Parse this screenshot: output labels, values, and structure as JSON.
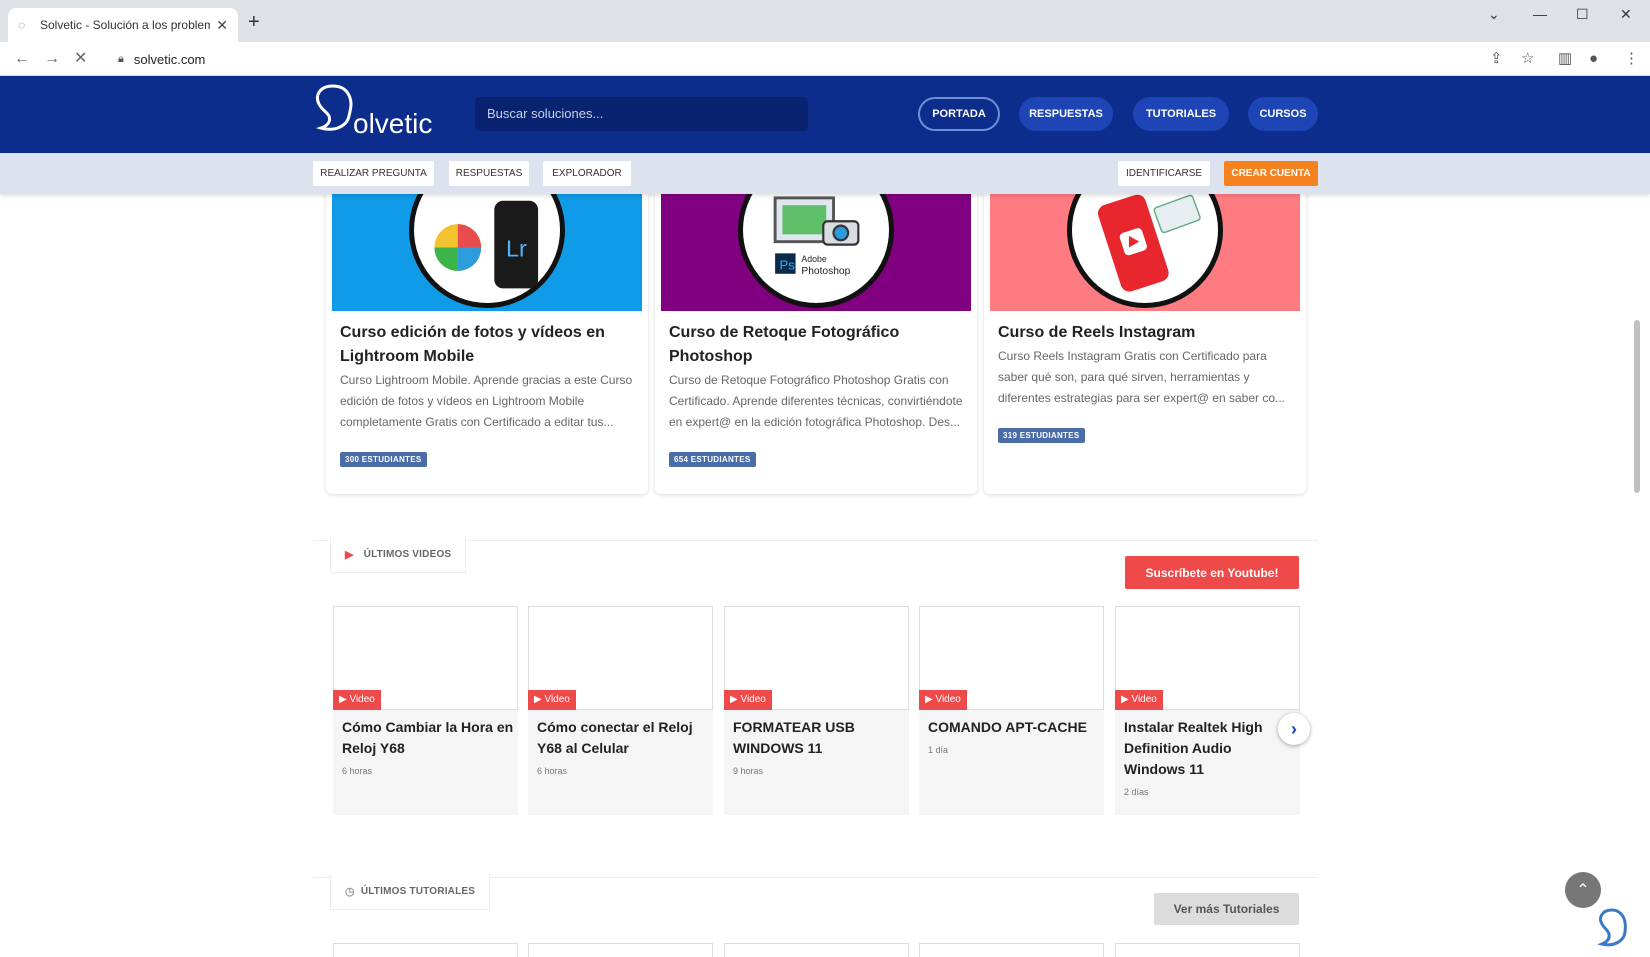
{
  "browser": {
    "tab_title": "Solvetic - Solución a los problem",
    "url": "solvetic.com"
  },
  "header": {
    "logo_text": "olvetic",
    "logo_lettering": "Solvetic",
    "search_placeholder": "Buscar soluciones...",
    "nav": [
      "PORTADA",
      "RESPUESTAS",
      "TUTORIALES",
      "CURSOS"
    ]
  },
  "subnav": {
    "realizar": "REALIZAR PREGUNTA",
    "respuestas": "RESPUESTAS",
    "explorador": "EXPLORADOR",
    "identificarse": "IDENTIFICARSE",
    "crear": "CREAR CUENTA"
  },
  "courses": [
    {
      "title": "Curso edición de fotos y vídeos en Lightroom Mobile",
      "desc": "Curso Lightroom Mobile. Aprende gracias a este Curso edición de fotos y vídeos en Lightroom Mobile completamente Gratis con Certificado a editar tus...",
      "students": "300 ESTUDIANTES",
      "bg": "#0f9be8"
    },
    {
      "title": "Curso de Retoque Fotográfico Photoshop",
      "desc": "Curso de Retoque Fotográfico Photoshop Gratis con Certificado. Aprende diferentes técnicas, convirtiéndote en expert@ en la edición fotográfica Photoshop. Des...",
      "students": "654 ESTUDIANTES",
      "bg": "#800080",
      "img_text_1": "Adobe",
      "img_text_2": "Photoshop"
    },
    {
      "title": "Curso de Reels Instagram",
      "desc": "Curso Reels Instagram Gratis con Certificado para saber qué son, para qué sirven, herramientas y diferentes estrategias para ser expert@ en saber co...",
      "students": "319 ESTUDIANTES",
      "bg": "#ff7b82"
    }
  ],
  "videos_section": {
    "label": "ÚLTIMOS VIDEOS",
    "subscribe": "Suscríbete en Youtube!",
    "badge": "Video",
    "items": [
      {
        "title": "Cómo Cambiar la Hora en Reloj Y68",
        "time": "6 horas"
      },
      {
        "title": "Cómo conectar el Reloj Y68 al Celular",
        "time": "6 horas"
      },
      {
        "title": "FORMATEAR USB WINDOWS 11",
        "time": "9 horas"
      },
      {
        "title": "COMANDO APT-CACHE",
        "time": "1 día"
      },
      {
        "title": "Instalar Realtek High Definition Audio Windows 11",
        "time": "2 días"
      }
    ]
  },
  "tutorials_section": {
    "label": "ÚLTIMOS TUTORIALES",
    "more": "Ver más Tutoriales"
  }
}
